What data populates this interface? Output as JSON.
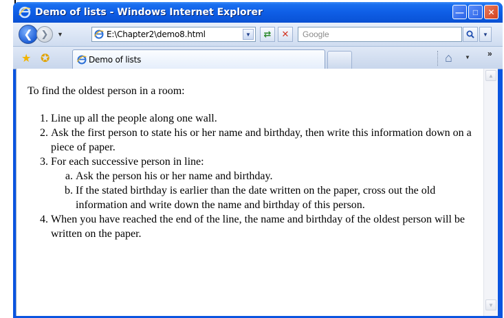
{
  "window": {
    "title": "Demo of lists - Windows Internet Explorer"
  },
  "address_bar": {
    "value": "E:\\Chapter2\\demo8.html"
  },
  "search_bar": {
    "placeholder": "Google"
  },
  "tab": {
    "label": "Demo of lists"
  },
  "content": {
    "intro": "To find the oldest person in a room:",
    "steps": [
      "Line up all the people along one wall.",
      "Ask the first person to state his or her name and birthday, then write this information down on a piece of paper.",
      "For each successive person in line:",
      "When you have reached the end of the line, the name and birthday of the oldest person will be written on the paper."
    ],
    "substeps": [
      "Ask the person his or her name and birthday.",
      "If the stated birthday is earlier than the date written on the paper, cross out the old information and write down the name and birthday of this person."
    ]
  },
  "icons": {
    "ie_logo": "internet-explorer-icon",
    "back": "back-arrow-icon",
    "forward": "forward-arrow-icon",
    "refresh": "refresh-icon",
    "stop": "stop-icon",
    "search": "search-icon",
    "favorites": "favorites-star-icon",
    "add_favorites": "add-favorites-icon",
    "home": "home-icon"
  },
  "colors": {
    "titlebar": "#0a54e0",
    "toolbar": "#dfe8f6",
    "text": "#000000"
  }
}
